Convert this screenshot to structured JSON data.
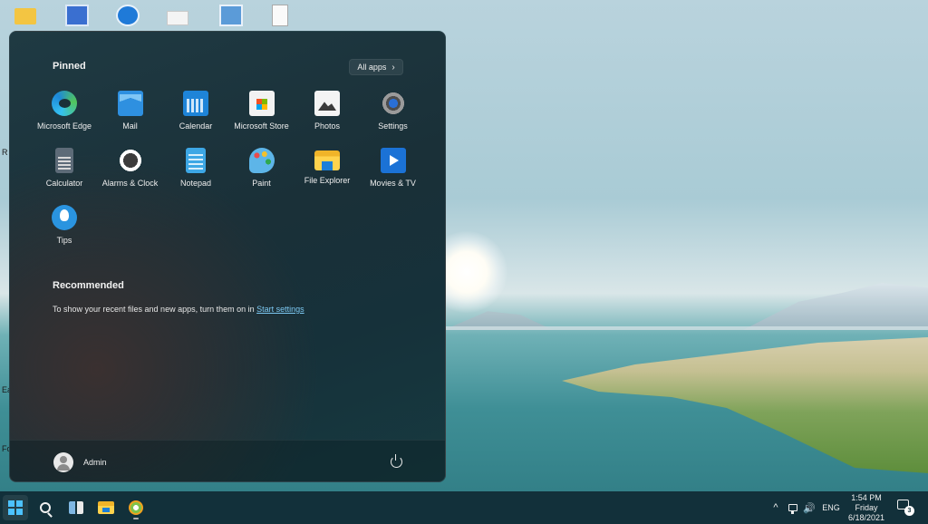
{
  "desktop": {
    "icons": [
      "folder-icon",
      "image-app-icon",
      "teamviewer-icon",
      "keyboard-icon",
      "installer-icon",
      "text-file-icon"
    ],
    "edge_labels": [
      "R",
      "Ea",
      "Fo"
    ]
  },
  "start_menu": {
    "pinned_title": "Pinned",
    "all_apps_label": "All apps",
    "pinned_apps": [
      {
        "label": "Microsoft Edge",
        "icon": "edge-icon"
      },
      {
        "label": "Mail",
        "icon": "mail-icon"
      },
      {
        "label": "Calendar",
        "icon": "calendar-icon"
      },
      {
        "label": "Microsoft Store",
        "icon": "store-icon"
      },
      {
        "label": "Photos",
        "icon": "photos-icon"
      },
      {
        "label": "Settings",
        "icon": "settings-icon"
      },
      {
        "label": "Calculator",
        "icon": "calculator-icon"
      },
      {
        "label": "Alarms & Clock",
        "icon": "alarm-clock-icon"
      },
      {
        "label": "Notepad",
        "icon": "notepad-icon"
      },
      {
        "label": "Paint",
        "icon": "paint-icon"
      },
      {
        "label": "File Explorer",
        "icon": "file-explorer-icon"
      },
      {
        "label": "Movies & TV",
        "icon": "movies-tv-icon"
      },
      {
        "label": "Tips",
        "icon": "tips-icon"
      }
    ],
    "recommended_title": "Recommended",
    "recommended_text": "To show your recent files and new apps, turn them on in ",
    "recommended_link": "Start settings",
    "user_name": "Admin"
  },
  "taskbar": {
    "items": [
      "start-button",
      "search-button",
      "task-view-button",
      "file-explorer-button",
      "app-button"
    ],
    "tray": {
      "chevron": "^",
      "volume": "🔊",
      "language": "ENG",
      "time": "1:54 PM",
      "day": "Friday",
      "date": "6/18/2021",
      "notification_count": "3"
    }
  },
  "colors": {
    "accent": "#4cc2ff",
    "link": "#7cc8f2",
    "taskbar_bg": "#12303a",
    "menu_bg": "#1a3038"
  }
}
